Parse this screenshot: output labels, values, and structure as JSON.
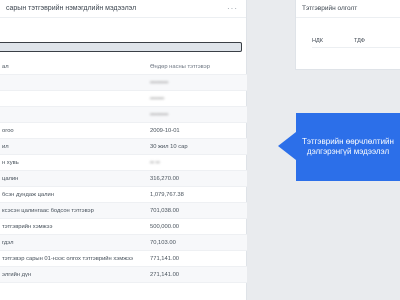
{
  "left_panel": {
    "title": "сарын тэтгэврийн нэмэгдлийн мэдээлэл",
    "menu_icon": "dots-menu-icon",
    "rows": [
      {
        "label": "ал",
        "value": "Өндөр насны тэтгэвэр"
      },
      {
        "label": "",
        "value": "•••••••••"
      },
      {
        "label": "",
        "value": "•••••••"
      },
      {
        "label": "",
        "value": "•••••••••"
      },
      {
        "label": "огоо",
        "value": "2009-10-01"
      },
      {
        "label": "ил",
        "value": "30 жил 10 сар"
      },
      {
        "label": "н хувь",
        "value": "•• ••"
      },
      {
        "label": "цалин",
        "value": "316,270.00"
      },
      {
        "label": "бсэн дундаж цалин",
        "value": "1,079,767.38"
      },
      {
        "label": "ксэсэн цалингаас бодсон тэтгэвэр",
        "value": "701,038.00"
      },
      {
        "label": "тэтгэврийн хэмжээ",
        "value": "500,000.00"
      },
      {
        "label": "гдэл",
        "value": "70,103.00"
      },
      {
        "label": "тэтгэвэр сарын 01-нээс олгох тэтгэврийн хэмжээ",
        "value": "771,141.00"
      },
      {
        "label": "элгийн дүн",
        "value": "271,141.00"
      }
    ]
  },
  "right_panel": {
    "title": "Тэтгэврийн олголт",
    "col1": "НДК",
    "col2": "ТДФ"
  },
  "callout": {
    "text": "Тэтгэврийн өөрчлөлтийн дэлгэрэнгүй мэдээлэл",
    "color": "#2c6fe9"
  }
}
